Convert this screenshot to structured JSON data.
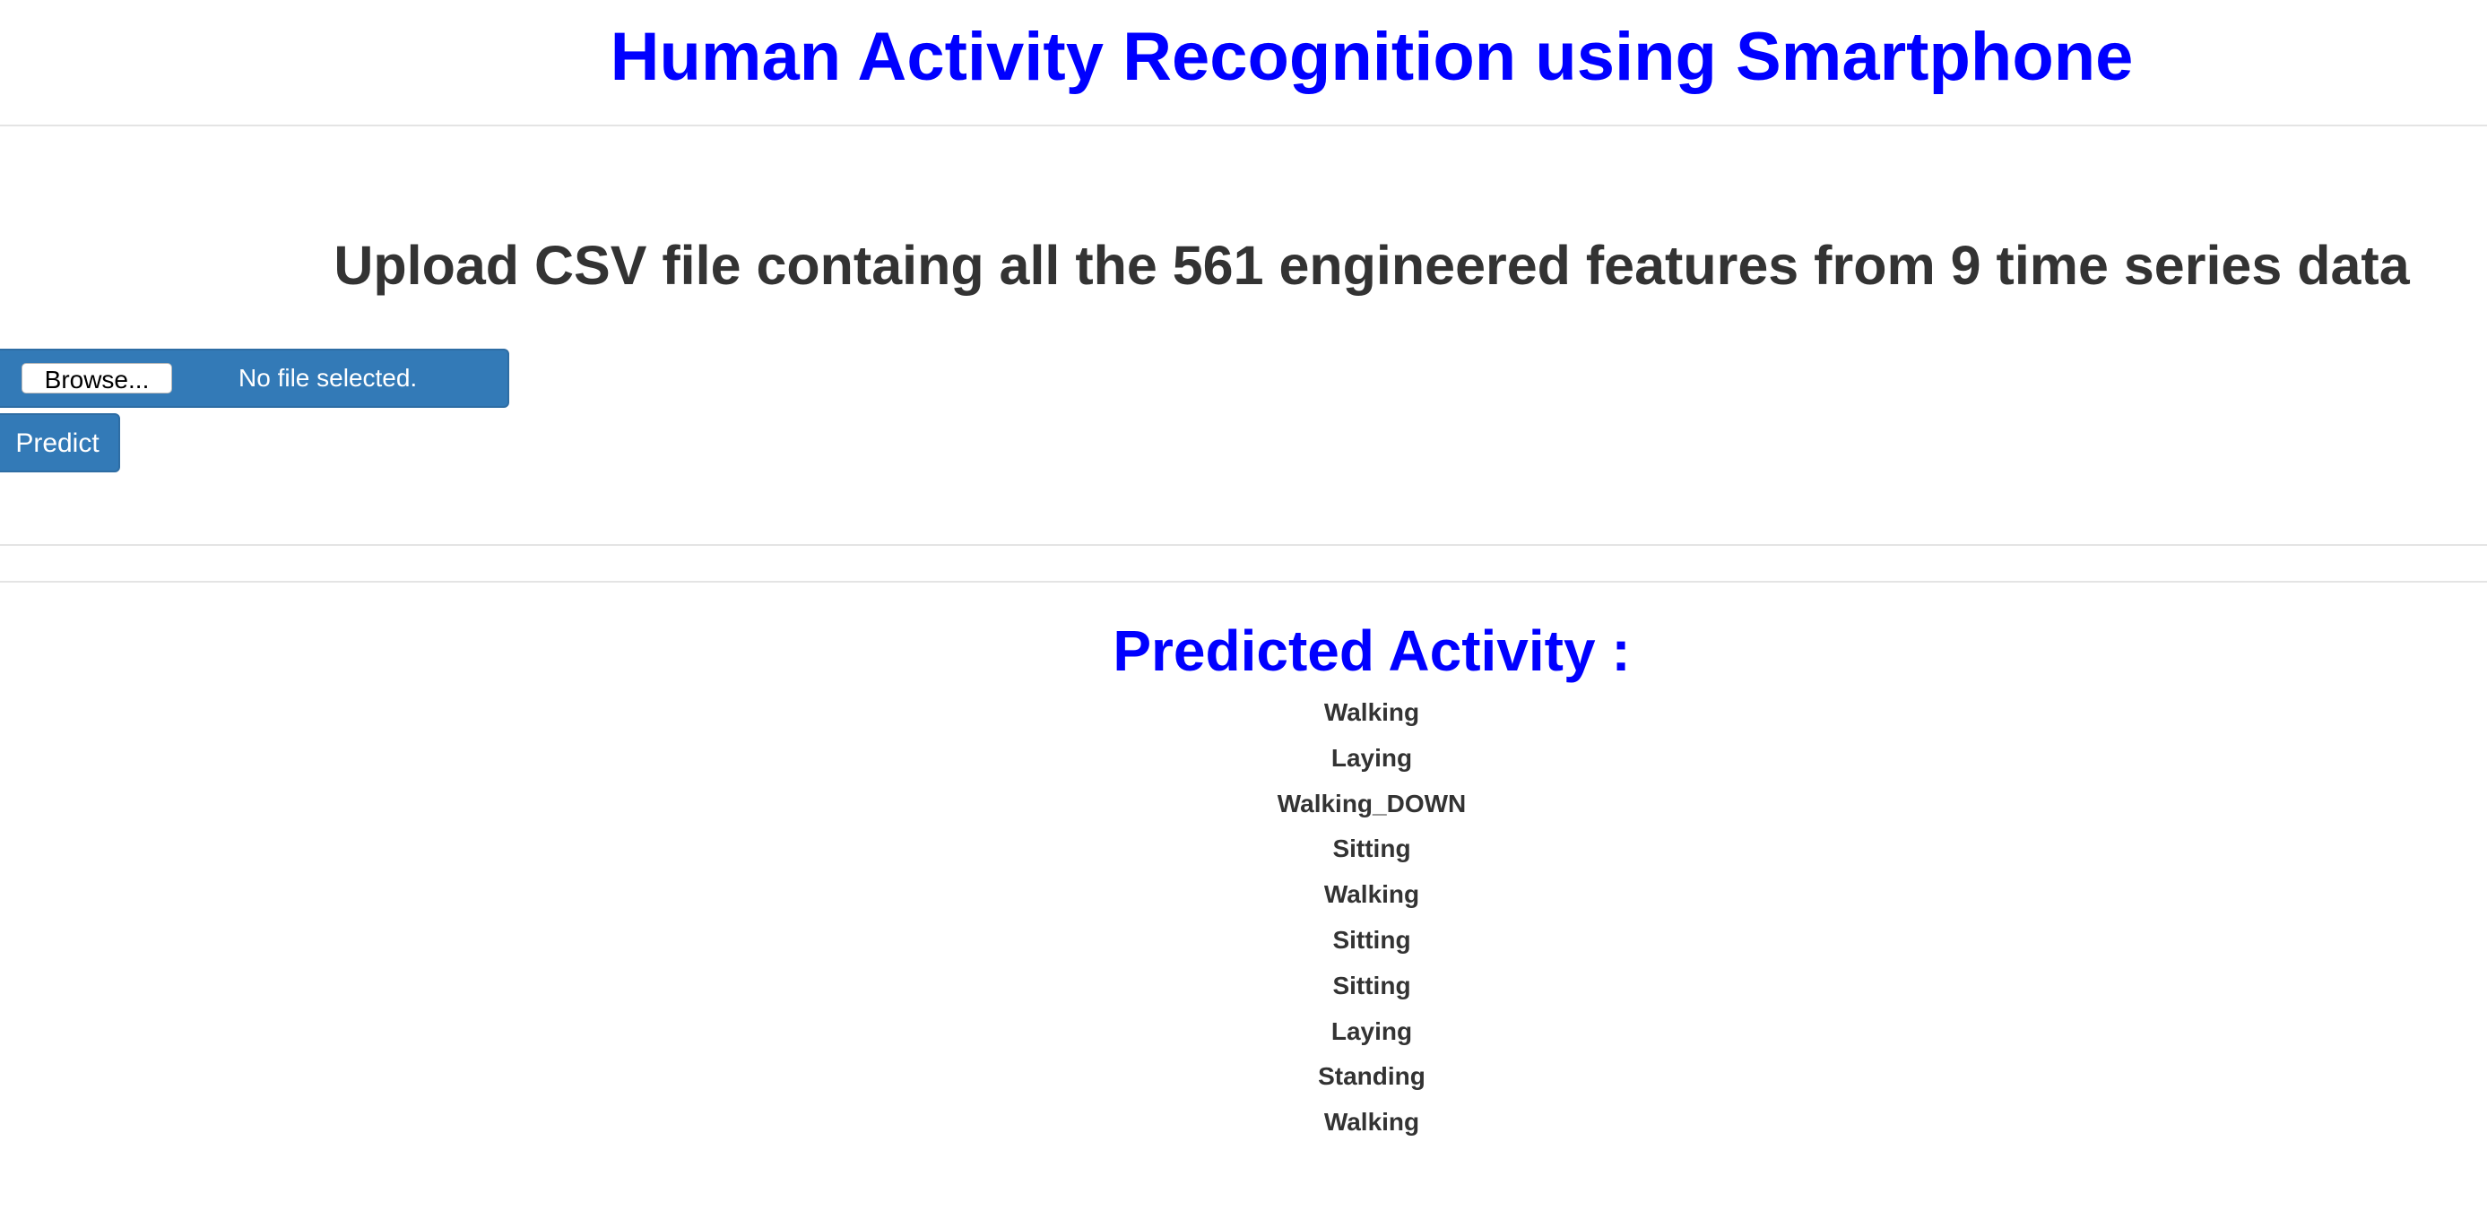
{
  "header": {
    "title": "Human Activity Recognition using Smartphone"
  },
  "upload": {
    "heading": "Upload CSV file containg all the 561 engineered features from 9 time series data",
    "browse_label": "Browse...",
    "file_status": "No file selected.",
    "predict_label": "Predict"
  },
  "results": {
    "heading": "Predicted Activity :",
    "predictions": [
      "Walking",
      "Laying",
      "Walking_DOWN",
      "Sitting",
      "Walking",
      "Sitting",
      "Sitting",
      "Laying",
      "Standing",
      "Walking"
    ]
  },
  "colors": {
    "title": "#0000ff",
    "button_bg": "#337ab7",
    "text": "#333333"
  }
}
